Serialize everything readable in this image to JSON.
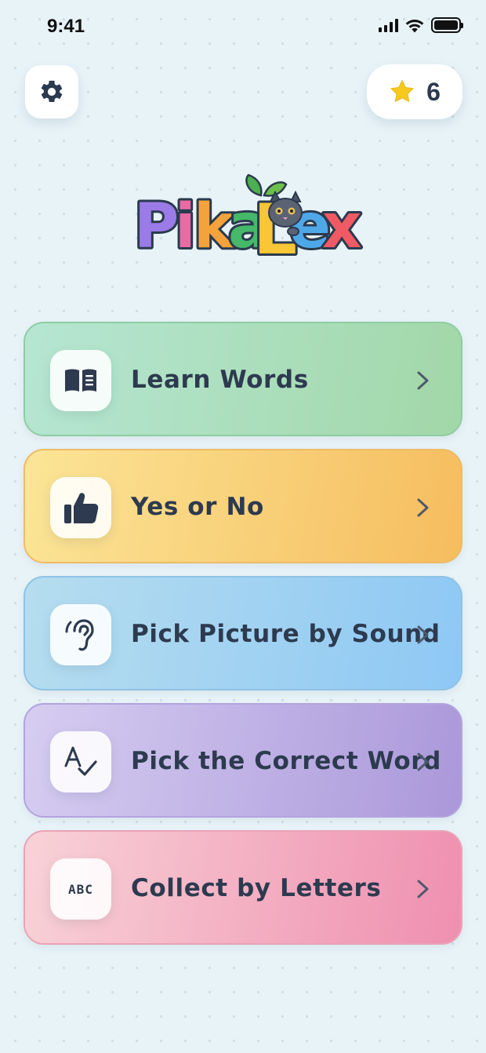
{
  "status_bar": {
    "time": "9:41"
  },
  "header": {
    "settings_icon": "gear-icon",
    "stars": {
      "icon": "star-icon",
      "count": "6",
      "star_color": "#f7c81e"
    }
  },
  "logo": {
    "text": "PikaLex",
    "letters": [
      {
        "char": "P",
        "color": "#9b7be8"
      },
      {
        "char": "i",
        "color": "#e86ba4"
      },
      {
        "char": "k",
        "color": "#f4a23c"
      },
      {
        "char": "a",
        "color": "#45b86a"
      },
      {
        "char": "L",
        "color": "#f8c636"
      },
      {
        "char": "e",
        "color": "#4ea8e8"
      },
      {
        "char": "x",
        "color": "#ef5a64"
      }
    ]
  },
  "menu": {
    "items": [
      {
        "label": "Learn Words",
        "icon": "book-icon",
        "gradient": [
          "#b6e6d3",
          "#a2d7a8"
        ],
        "border": "#8fcda2"
      },
      {
        "label": "Yes or No",
        "icon": "thumbs-up-icon",
        "gradient": [
          "#fbe597",
          "#f6bd5e"
        ],
        "border": "#edbb6a"
      },
      {
        "label": "Pick Picture by Sound",
        "icon": "ear-icon",
        "gradient": [
          "#b6ddef",
          "#8ec8f4"
        ],
        "border": "#8ec3e6"
      },
      {
        "label": "Pick the Correct Word",
        "icon": "spell-check-icon",
        "gradient": [
          "#d6cdf1",
          "#aa98da"
        ],
        "border": "#b3a3de"
      },
      {
        "label": "Collect by Letters",
        "icon": "abc-icon",
        "icon_text": "ABC",
        "gradient": [
          "#f8d2d7",
          "#ef8fb0"
        ],
        "border": "#eaa3b6"
      }
    ]
  }
}
